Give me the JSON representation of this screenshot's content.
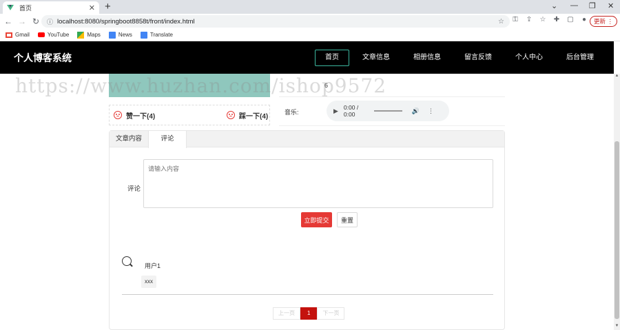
{
  "browser": {
    "tab_title": "首页",
    "url": "localhost:8080/springboot8858t/front/index.html",
    "update_label": "更新",
    "bookmarks": [
      {
        "label": "Gmail",
        "icon": "gmail-icon",
        "color": "#ea4335"
      },
      {
        "label": "YouTube",
        "icon": "youtube-icon",
        "color": "#ff0000"
      },
      {
        "label": "Maps",
        "icon": "maps-icon",
        "color": "#34a853"
      },
      {
        "label": "News",
        "icon": "news-icon",
        "color": "#4285f4"
      },
      {
        "label": "Translate",
        "icon": "translate-icon",
        "color": "#4285f4"
      }
    ]
  },
  "site": {
    "title": "个人博客系统",
    "nav": [
      {
        "label": "首页",
        "active": true
      },
      {
        "label": "文章信息",
        "active": false
      },
      {
        "label": "相册信息",
        "active": false
      },
      {
        "label": "留言反馈",
        "active": false
      },
      {
        "label": "个人中心",
        "active": false
      },
      {
        "label": "后台管理",
        "active": false
      }
    ],
    "accent": "#3cb8a0"
  },
  "article": {
    "like_label": "赞一下(4)",
    "dislike_label": "踩一下(4)",
    "stat_value": "6",
    "music_label": "音乐:",
    "audio_time": "0:00 / 0:00"
  },
  "tabs": {
    "items": [
      "文章内容",
      "评论"
    ],
    "active_index": 1
  },
  "comment_form": {
    "label": "评论",
    "placeholder": "请输入内容",
    "submit_label": "立即提交",
    "reset_label": "重置",
    "submit_color": "#e53935"
  },
  "comments": [
    {
      "user": "用户1",
      "text": "xxx"
    }
  ],
  "pager": {
    "prev": "上一页",
    "current": "1",
    "next": "下一页"
  },
  "watermark": "https://www.huzhan.com/ishop9572"
}
